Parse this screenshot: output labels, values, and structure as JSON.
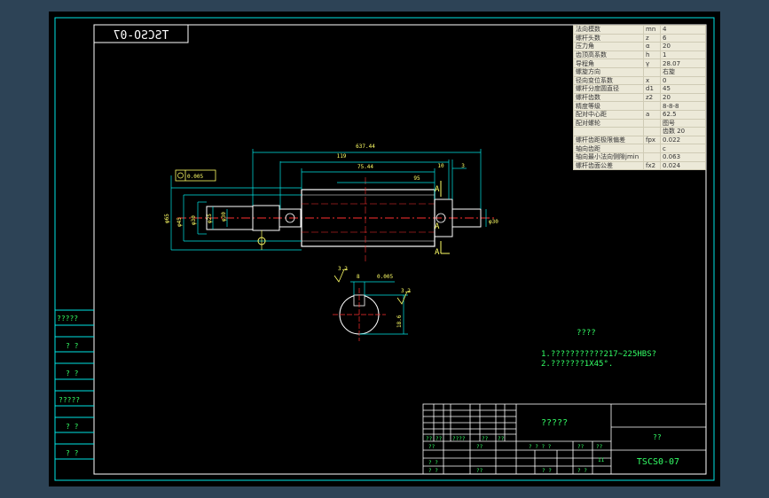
{
  "drawing": {
    "part_code_mirrored": "TSCSO-07",
    "part_code": "TSCS0-07",
    "title_cell": "?????",
    "designer_cell": "??"
  },
  "params": [
    {
      "name": "法向模数",
      "sym": "mn",
      "val": "4"
    },
    {
      "name": "螺杆头数",
      "sym": "z",
      "val": "6"
    },
    {
      "name": "压力角",
      "sym": "α",
      "val": "20"
    },
    {
      "name": "齿顶高系数",
      "sym": "h",
      "val": "1"
    },
    {
      "name": "导程角",
      "sym": "γ",
      "val": "28.07"
    },
    {
      "name": "螺旋方向",
      "sym": "",
      "val": "右旋"
    },
    {
      "name": "径向变位系数",
      "sym": "x",
      "val": "0"
    },
    {
      "name": "螺杆分度圆直径",
      "sym": "d1",
      "val": "45"
    },
    {
      "name": "螺杆齿数",
      "sym": "z2",
      "val": "20"
    },
    {
      "name": "精度等级",
      "sym": "",
      "val": "8-8-8"
    },
    {
      "name": "配对中心距",
      "sym": "a",
      "val": "62.5"
    },
    {
      "name": "配对螺轮",
      "sym": "",
      "val": "图号"
    },
    {
      "name": "",
      "sym": "",
      "val": "齿数 20"
    },
    {
      "name": "螺杆齿距极限偏差",
      "sym": "fpx",
      "val": "0.022"
    },
    {
      "name": "轴向齿距",
      "sym": "",
      "val": "c"
    },
    {
      "name": "轴向最小法向侧隙jmin",
      "sym": "",
      "val": "0.063"
    },
    {
      "name": "螺杆齿面公差",
      "sym": "fx2",
      "val": "0.024"
    }
  ],
  "dimensions": {
    "total_length": "637.44",
    "len_a": "119",
    "len_b": "75.44",
    "len_c": "10",
    "len_d": "3",
    "len_e": "95",
    "dia_small": "φ30",
    "dia_main": "φ45",
    "dia_1": "φ65",
    "dia_2": "φ30",
    "dia_3": "φ25",
    "tol_box": "0.005",
    "section_rough": "3.2",
    "section_tol": "0.005",
    "section_rough2": "3.2",
    "section_width": "8",
    "section_depth": "18.6"
  },
  "labels": {
    "datum_a1": "A",
    "datum_a2": "A",
    "datum_a3": "A",
    "left_cells": [
      "?????",
      "? ?",
      "? ?",
      "?????",
      "? ?",
      "? ?"
    ],
    "notes_title": "????",
    "note1": "1.???????????217~225HBS?",
    "note2": "2.???????1X45°.",
    "tb_r1": [
      "??",
      "??",
      "????",
      "??",
      "??"
    ],
    "tb_r2": [
      "??",
      "??",
      "? ?",
      "? ?",
      "11"
    ],
    "tb_r3": [
      "??",
      "??",
      "? ?",
      "? ?"
    ],
    "tb_r4": [
      "? ? ? ?",
      "??",
      "??"
    ]
  },
  "colors": {
    "background": "#000000",
    "frame": "#00e5e5",
    "yellow": "#ffff66",
    "red": "#ff3030",
    "green": "#33ff66",
    "white": "#ffffff"
  }
}
